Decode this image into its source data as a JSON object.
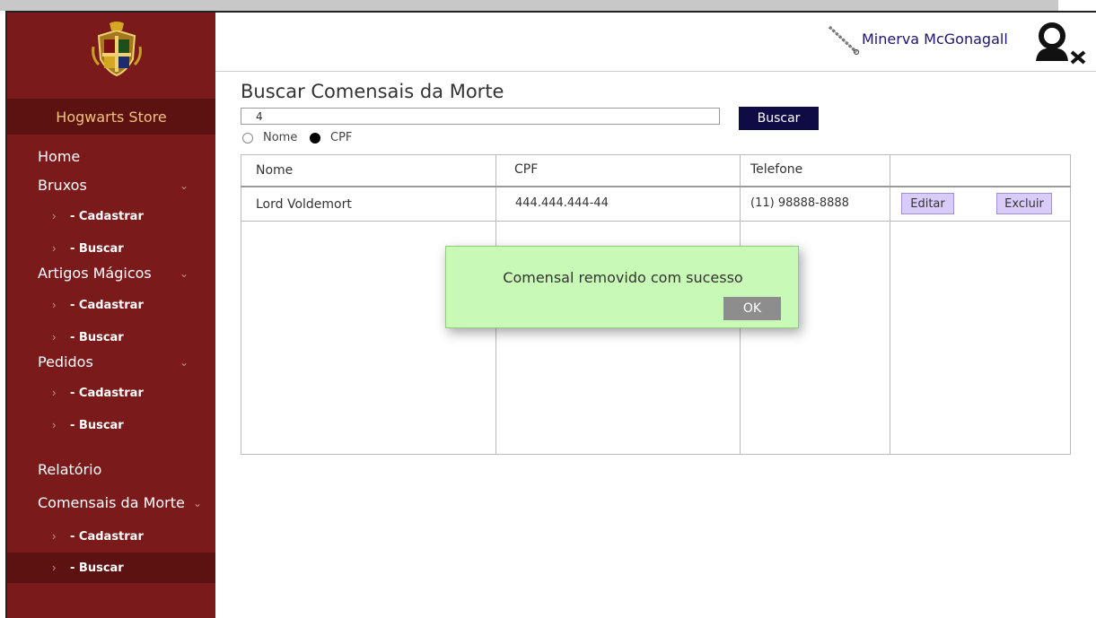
{
  "app": {
    "store_name": "Hogwarts Store"
  },
  "header": {
    "user_name": "Minerva McGonagall"
  },
  "sidebar": {
    "home": "Home",
    "groups": [
      {
        "label": "Bruxos",
        "subs": [
          "- Cadastrar",
          "- Buscar"
        ]
      },
      {
        "label": "Artigos Mágicos",
        "subs": [
          "- Cadastrar",
          "- Buscar"
        ]
      },
      {
        "label": "Pedidos",
        "subs": [
          "- Cadastrar",
          "- Buscar"
        ]
      }
    ],
    "relatorio": "Relatório",
    "comensais": {
      "label": "Comensais da Morte",
      "subs": [
        "- Cadastrar",
        "- Buscar"
      ]
    }
  },
  "main": {
    "title": "Buscar Comensais da Morte",
    "search_value": "4",
    "search_button": "Buscar",
    "radio_options": [
      "Nome",
      "CPF"
    ],
    "radio_selected": "CPF",
    "table": {
      "headers": [
        "Nome",
        "CPF",
        "Telefone",
        ""
      ],
      "rows": [
        {
          "nome": "Lord Voldemort",
          "cpf": "444.444.444-44",
          "telefone": "(11) 98888-8888",
          "edit": "Editar",
          "delete": "Excluir"
        }
      ]
    }
  },
  "modal": {
    "message": "Comensal removido  com sucesso",
    "ok": "OK"
  },
  "colors": {
    "sidebar": "#7b1a1a",
    "sidebar_dark": "#5d1212",
    "store_text": "#f1c27a",
    "search_button": "#0e0b45",
    "modal_bg": "#c9f9b6",
    "row_button": "#d9ccfa",
    "user_name": "#1b1570"
  },
  "icons": [
    "hogwarts-crest-logo",
    "wand-icon",
    "user-remove-icon",
    "chevron-right-icon",
    "chevron-down-icon"
  ]
}
